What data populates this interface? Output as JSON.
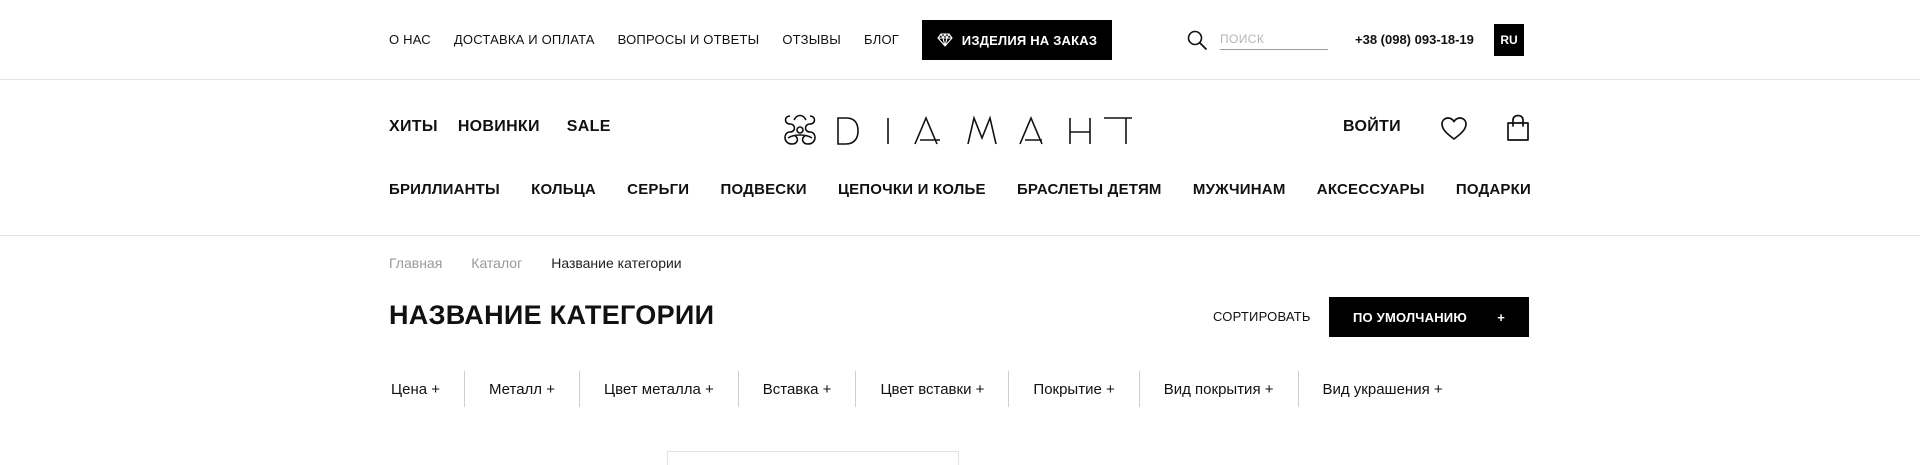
{
  "topbar": {
    "nav": [
      "О НАС",
      "ДОСТАВКА И ОПЛАТА",
      "ВОПРОСЫ И ОТВЕТЫ",
      "ОТЗЫВЫ",
      "БЛОГ"
    ],
    "order_label": "ИЗДЕЛИЯ НА ЗАКАЗ",
    "search_placeholder": "ПОИСК",
    "phone": "+38 (098) 093-18-19",
    "lang": "RU"
  },
  "header": {
    "quick_links": [
      "ХИТЫ",
      "НОВИНКИ",
      "SALE"
    ],
    "logo_text": "DIAMAHT",
    "login_label": "ВОЙТИ",
    "categories": [
      "БРИЛЛИАНТЫ",
      "КОЛЬЦА",
      "СЕРЬГИ",
      "ПОДВЕСКИ",
      "ЦЕПОЧКИ И КОЛЬЕ",
      "БРАСЛЕТЫ ДЕТЯМ",
      "МУЖЧИНАМ",
      "АКСЕССУАРЫ",
      "ПОДАРКИ"
    ]
  },
  "breadcrumb": {
    "home": "Главная",
    "catalog": "Каталог",
    "current": "Название категории"
  },
  "page": {
    "title": "НАЗВАНИЕ КАТЕГОРИИ",
    "sort_label": "СОРТИРОВАТЬ",
    "sort_value": "ПО УМОЛЧАНИЮ",
    "sort_toggle": "+"
  },
  "filters": [
    "Цена +",
    "Металл +",
    "Цвет металла +",
    "Вставка +",
    "Цвет вставки +",
    "Покрытие +",
    "Вид покрытия +",
    "Вид украшения +"
  ]
}
